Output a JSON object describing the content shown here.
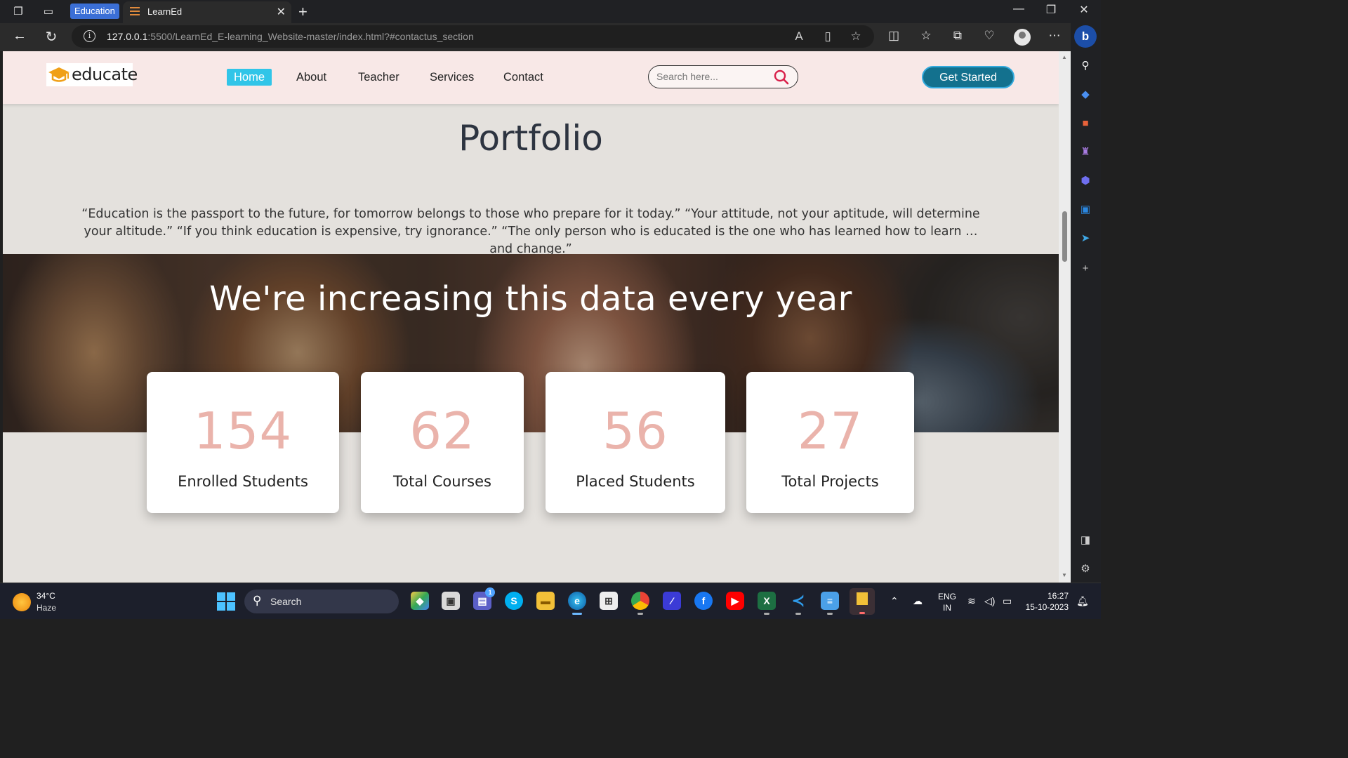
{
  "browser": {
    "tab_group": "Education",
    "active_tab_title": "LearnEd",
    "url_host": "127.0.0.1",
    "url_rest": ":5500/LearnEd_E-learning_Website-master/index.html?#contactus_section"
  },
  "site": {
    "logo_text": "educate",
    "nav": [
      "Home",
      "About",
      "Teacher",
      "Services",
      "Contact"
    ],
    "search_placeholder": "Search here...",
    "cta": "Get Started"
  },
  "portfolio": {
    "title": "Portfolio",
    "quote": "“Education is the passport to the future, for tomorrow belongs to those who prepare for it today.” “Your attitude, not your aptitude, will determine your altitude.” “If you think education is expensive, try ignorance.” “The only person who is educated is the one who has learned how to learn …and change.”"
  },
  "stats": {
    "heading": "We're increasing this data every year",
    "items": [
      {
        "value": "154",
        "label": "Enrolled Students"
      },
      {
        "value": "62",
        "label": "Total Courses"
      },
      {
        "value": "56",
        "label": "Placed Students"
      },
      {
        "value": "27",
        "label": "Total Projects"
      }
    ]
  },
  "taskbar": {
    "weather_temp": "34°C",
    "weather_cond": "Haze",
    "search_label": "Search",
    "teams_badge": "1",
    "lang": "ENG",
    "region": "IN",
    "time": "16:27",
    "date": "15-10-2023"
  },
  "colors": {
    "accent_nav": "#31c5e8",
    "cta": "#13718e",
    "stat_number": "#eab3ab",
    "header_bg": "#f8e8e7"
  }
}
